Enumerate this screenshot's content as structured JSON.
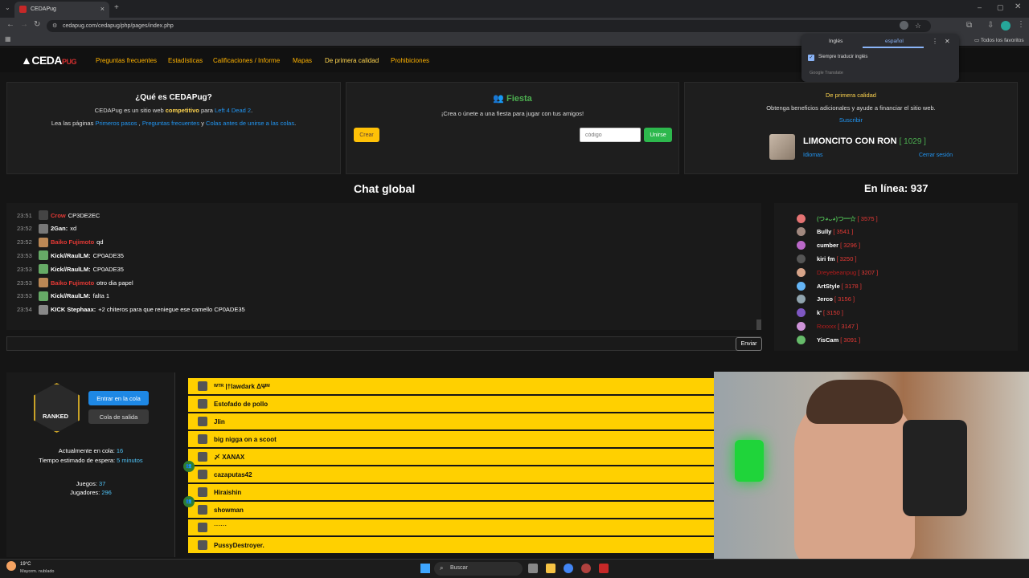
{
  "browser": {
    "tab_title": "CEDAPug",
    "url": "cedapug.com/cedapug/php/pages/index.php",
    "bookmarks_all": "Todos los favoritos"
  },
  "translate": {
    "lang_from": "Inglés",
    "lang_to": "español",
    "always_translate": "Siempre traducir inglés",
    "provider": "Google Translate"
  },
  "site": {
    "logo_main": "CEDA",
    "logo_accent": "PUG",
    "nav": [
      "Preguntas frecuentes",
      "Estadísticas",
      "Calificaciones / Informe",
      "Mapas",
      "De primera calidad",
      "Prohibiciones"
    ]
  },
  "about": {
    "title": "¿Qué es CEDAPug?",
    "line1_a": "CEDAPug es un sitio web ",
    "line1_b": "competitivo",
    "line1_c": " para ",
    "line1_d": "Left 4 Dead 2",
    "line1_e": ".",
    "line2_a": "Lea las páginas ",
    "line2_b": "Primeros pasos",
    "line2_c": " , ",
    "line2_d": "Preguntas frecuentes",
    "line2_e": " y ",
    "line2_f": "Colas antes de unirse a las colas",
    "line2_g": "."
  },
  "party": {
    "title": "Fiesta",
    "desc": "¡Crea o únete a una fiesta para jugar con tus amigos!",
    "create_label": "Crear",
    "code_placeholder": "código",
    "join_label": "Unirse"
  },
  "premium": {
    "title": "De primera calidad",
    "desc": "Obtenga beneficios adicionales y ayude a financiar el sitio web.",
    "subscribe": "Suscribir",
    "username": "LIMONCITO CON RON",
    "rating": "[ 1029 ]",
    "languages": "Idiomas",
    "logout": "Cerrar sesión"
  },
  "chat": {
    "title": "Chat global",
    "send_label": "Enviar",
    "messages": [
      {
        "time": "23:51",
        "user": "Crow",
        "red": true,
        "text": "CP3DE2EC"
      },
      {
        "time": "23:52",
        "user": "2Gan:",
        "red": false,
        "text": "xd"
      },
      {
        "time": "23:52",
        "user": "Baiko Fujimoto",
        "red": true,
        "text": "qd"
      },
      {
        "time": "23:53",
        "user": "Kick//RaulLM:",
        "red": false,
        "text": "CP0ADE35"
      },
      {
        "time": "23:53",
        "user": "Kick//RaulLM:",
        "red": false,
        "text": "CP0ADE35"
      },
      {
        "time": "23:53",
        "user": "Baiko Fujimoto",
        "red": true,
        "text": "otro dia papel"
      },
      {
        "time": "23:53",
        "user": "Kick//RaulLM:",
        "red": false,
        "text": "falta 1"
      },
      {
        "time": "23:54",
        "user": "KICK Stephaax:",
        "red": false,
        "text": "+2 chiteros para que reniegue ese camello CP0ADE35"
      }
    ]
  },
  "online": {
    "title": "En línea: 937",
    "users": [
      {
        "name": "(つ◕ᴗ◕)つ━☆",
        "score": "[ 3575 ]",
        "green": true,
        "red": false
      },
      {
        "name": "Bully",
        "score": "[ 3541 ]",
        "green": false,
        "red": false
      },
      {
        "name": "cumber",
        "score": "[ 3296 ]",
        "green": false,
        "red": false
      },
      {
        "name": "kiri fm",
        "score": "[ 3250 ]",
        "green": false,
        "red": false
      },
      {
        "name": "Dreyebeanpug",
        "score": "[ 3207 ]",
        "green": false,
        "red": true
      },
      {
        "name": "ArtStyle",
        "score": "[ 3178 ]",
        "green": false,
        "red": false
      },
      {
        "name": "Jerco",
        "score": "[ 3156 ]",
        "green": false,
        "red": false
      },
      {
        "name": "k'",
        "score": "[ 3150 ]",
        "green": false,
        "red": false
      },
      {
        "name": "Rxxxxx",
        "score": "[ 3147 ]",
        "green": false,
        "red": true
      },
      {
        "name": "YisCam",
        "score": "[ 3091 ]",
        "green": false,
        "red": false
      }
    ]
  },
  "queue": {
    "badge": "RANKED",
    "join_label": "Entrar en la cola",
    "leave_label": "Cola de salida",
    "in_queue_label": "Actualmente en cola: ",
    "in_queue_value": "16",
    "wait_label": "Tiempo estimado de espera: ",
    "wait_value": "5 minutos",
    "games_label": "Juegos: ",
    "games_value": "37",
    "players_label": "Jugadores: ",
    "players_value": "296",
    "players": [
      "ᵂᵀᴿ |†lawdark ΔΨᴹ",
      "Estofado de pollo",
      "Jlin",
      "big nigga on a scoot",
      "〆 XANAX",
      "cazaputas42",
      "Hiraishin",
      "showman",
      "˙˙˙˙˙˙",
      "PussyDestroyer."
    ]
  },
  "taskbar": {
    "weather_temp": "19°C",
    "weather_desc": "Mayorm. nublado",
    "search": "Buscar"
  }
}
